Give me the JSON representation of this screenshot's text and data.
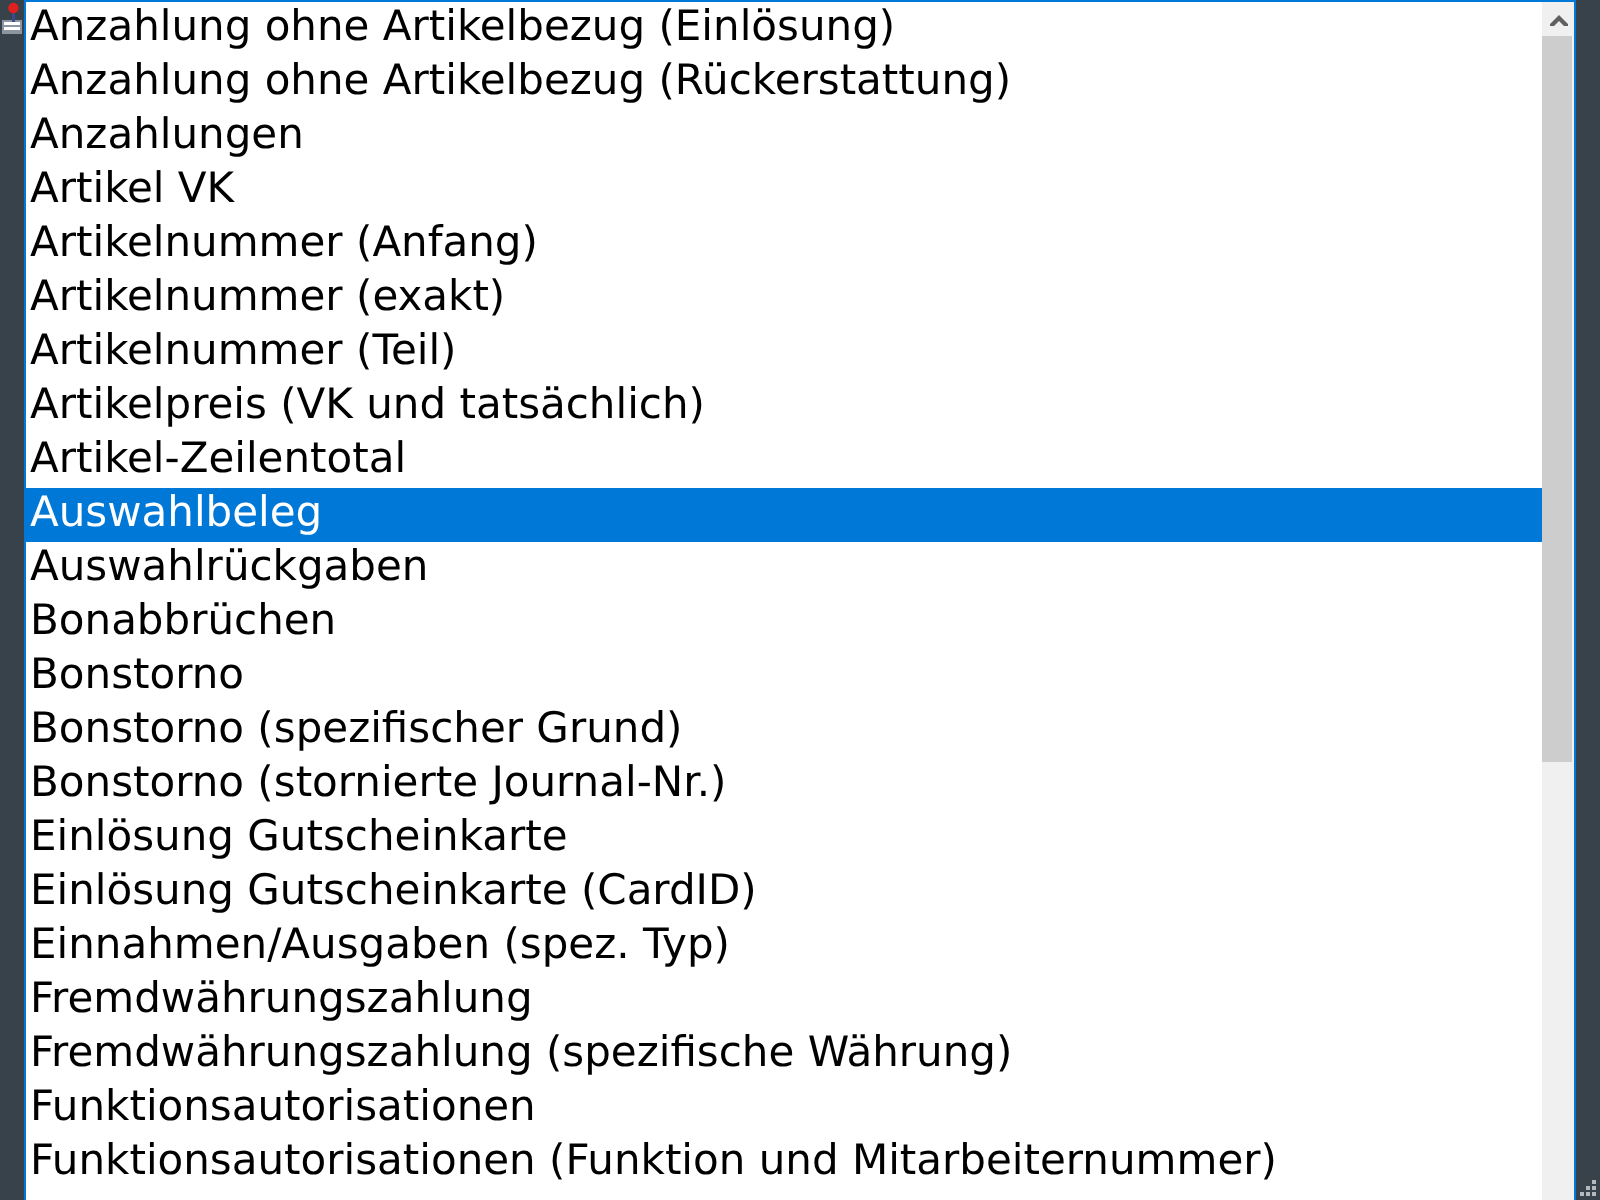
{
  "items": [
    {
      "label": "Anzahlung ohne Artikelbezug (Einlösung)",
      "selected": false
    },
    {
      "label": "Anzahlung ohne Artikelbezug (Rückerstattung)",
      "selected": false
    },
    {
      "label": "Anzahlungen",
      "selected": false
    },
    {
      "label": "Artikel VK",
      "selected": false
    },
    {
      "label": "Artikelnummer (Anfang)",
      "selected": false
    },
    {
      "label": "Artikelnummer (exakt)",
      "selected": false
    },
    {
      "label": "Artikelnummer (Teil)",
      "selected": false
    },
    {
      "label": "Artikelpreis (VK und tatsächlich)",
      "selected": false
    },
    {
      "label": "Artikel-Zeilentotal",
      "selected": false
    },
    {
      "label": "Auswahlbeleg",
      "selected": true
    },
    {
      "label": "Auswahlrückgaben",
      "selected": false
    },
    {
      "label": "Bonabbrüchen",
      "selected": false
    },
    {
      "label": "Bonstorno",
      "selected": false
    },
    {
      "label": "Bonstorno (spezifischer Grund)",
      "selected": false
    },
    {
      "label": "Bonstorno (stornierte Journal-Nr.)",
      "selected": false
    },
    {
      "label": "Einlösung Gutscheinkarte",
      "selected": false
    },
    {
      "label": "Einlösung Gutscheinkarte (CardID)",
      "selected": false
    },
    {
      "label": "Einnahmen/Ausgaben (spez. Typ)",
      "selected": false
    },
    {
      "label": "Fremdwährungszahlung",
      "selected": false
    },
    {
      "label": "Fremdwährungszahlung (spezifische Währung)",
      "selected": false
    },
    {
      "label": "Funktionsautorisationen",
      "selected": false
    },
    {
      "label": "Funktionsautorisationen (Funktion und Mitarbeiternummer)",
      "selected": false
    }
  ]
}
